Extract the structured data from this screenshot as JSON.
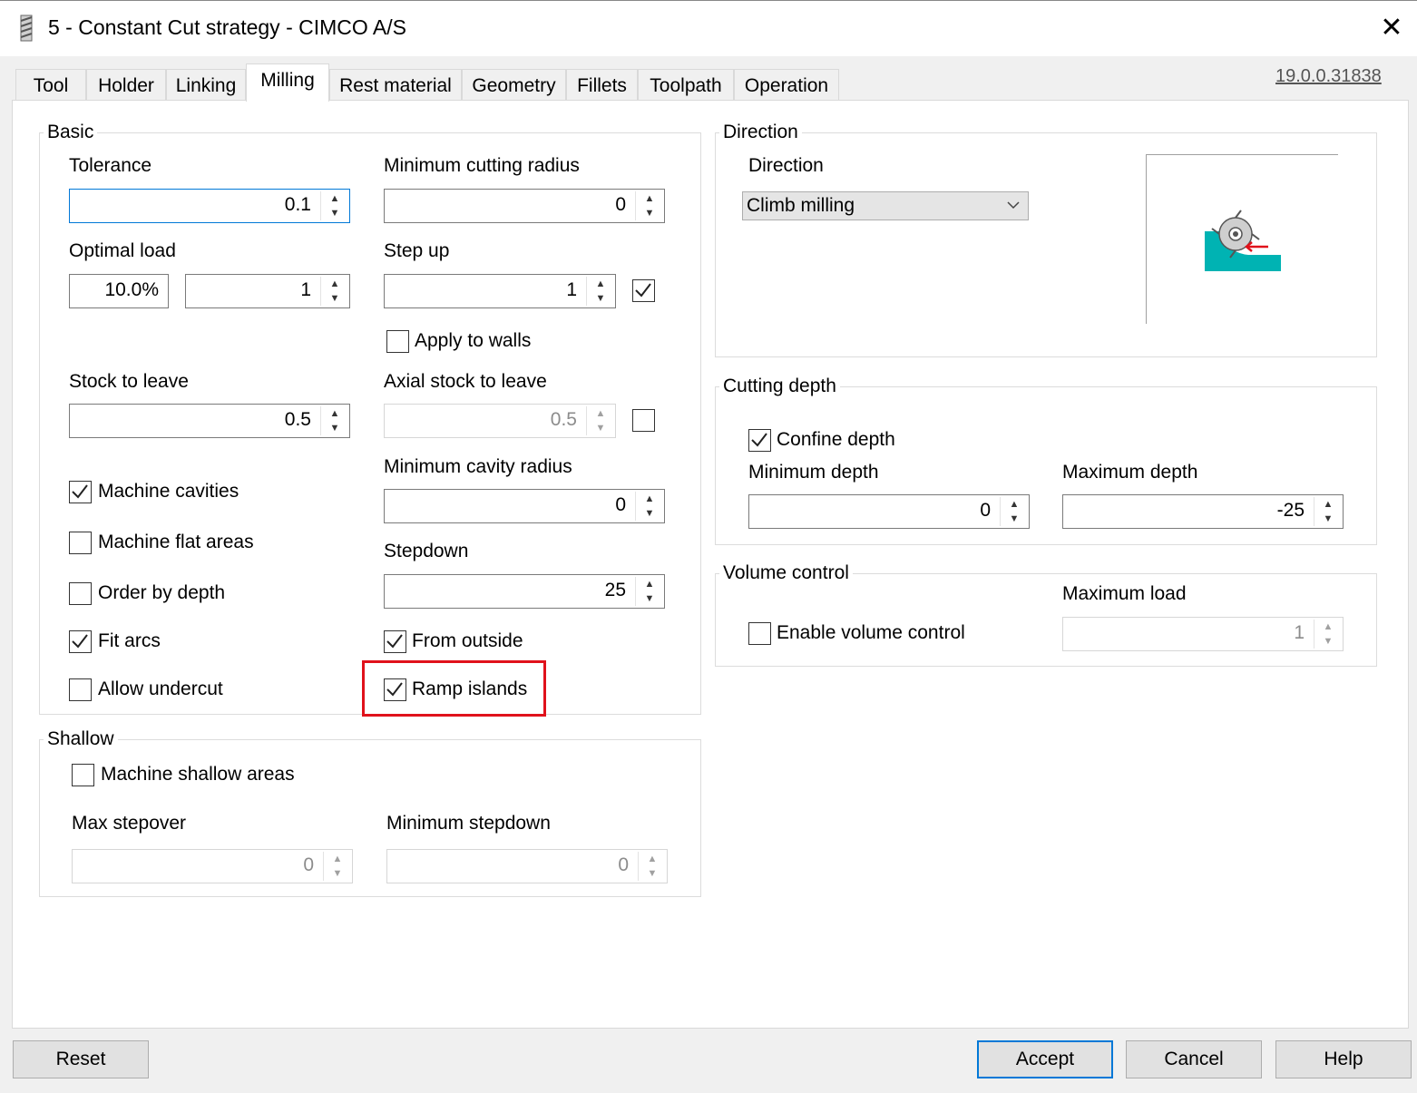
{
  "window": {
    "title": "5 - Constant Cut strategy - CIMCO A/S",
    "close_glyph": "✕",
    "app_icon": "drill-bit-icon"
  },
  "tabs": [
    {
      "label": "Tool",
      "active": false
    },
    {
      "label": "Holder",
      "active": false
    },
    {
      "label": "Linking",
      "active": false
    },
    {
      "label": "Milling",
      "active": true
    },
    {
      "label": "Rest material",
      "active": false
    },
    {
      "label": "Geometry",
      "active": false
    },
    {
      "label": "Fillets",
      "active": false
    },
    {
      "label": "Toolpath",
      "active": false
    },
    {
      "label": "Operation",
      "active": false
    }
  ],
  "version": "19.0.0.31838",
  "basic": {
    "title": "Basic",
    "tolerance": {
      "label": "Tolerance",
      "value": "0.1"
    },
    "min_cutting_radius": {
      "label": "Minimum cutting radius",
      "value": "0"
    },
    "optimal_load": {
      "label": "Optimal load",
      "percent": "10.0%",
      "value": "1"
    },
    "step_up": {
      "label": "Step up",
      "value": "1",
      "checked": true
    },
    "apply_to_walls": {
      "label": "Apply to walls",
      "checked": false
    },
    "stock_to_leave": {
      "label": "Stock to leave",
      "value": "0.5"
    },
    "axial_stock_to_leave": {
      "label": "Axial stock to leave",
      "value": "0.5",
      "checked": false
    },
    "min_cavity_radius": {
      "label": "Minimum cavity radius",
      "value": "0"
    },
    "stepdown": {
      "label": "Stepdown",
      "value": "25"
    },
    "machine_cavities": {
      "label": "Machine cavities",
      "checked": true
    },
    "machine_flat_areas": {
      "label": "Machine flat areas",
      "checked": false
    },
    "order_by_depth": {
      "label": "Order by depth",
      "checked": false
    },
    "fit_arcs": {
      "label": "Fit arcs",
      "checked": true
    },
    "allow_undercut": {
      "label": "Allow undercut",
      "checked": false
    },
    "from_outside": {
      "label": "From outside",
      "checked": true
    },
    "ramp_islands": {
      "label": "Ramp islands",
      "checked": true
    }
  },
  "shallow": {
    "title": "Shallow",
    "machine_shallow_areas": {
      "label": "Machine shallow areas",
      "checked": false
    },
    "max_stepover": {
      "label": "Max stepover",
      "value": "0"
    },
    "min_stepdown": {
      "label": "Minimum stepdown",
      "value": "0"
    }
  },
  "direction": {
    "title": "Direction",
    "label": "Direction",
    "selected": "Climb milling"
  },
  "cutting_depth": {
    "title": "Cutting depth",
    "confine_depth": {
      "label": "Confine depth",
      "checked": true
    },
    "min_depth": {
      "label": "Minimum depth",
      "value": "0"
    },
    "max_depth": {
      "label": "Maximum depth",
      "value": "-25"
    }
  },
  "volume_control": {
    "title": "Volume control",
    "enable": {
      "label": "Enable volume control",
      "checked": false
    },
    "max_load": {
      "label": "Maximum load",
      "value": "1"
    }
  },
  "buttons": {
    "reset": "Reset",
    "accept": "Accept",
    "cancel": "Cancel",
    "help": "Help"
  },
  "colors": {
    "accent": "#0078d7",
    "highlight": "#e0121b",
    "preview_teal": "#00b3b3"
  }
}
